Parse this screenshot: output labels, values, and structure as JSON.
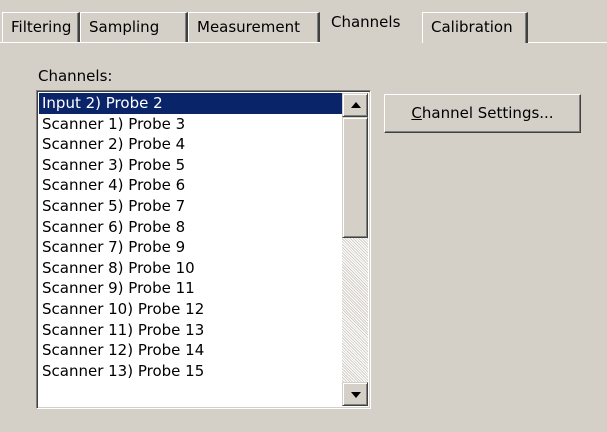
{
  "tabs": [
    {
      "label": "Filtering"
    },
    {
      "label": "Sampling"
    },
    {
      "label": "Measurement"
    },
    {
      "label": "Channels",
      "active": true
    },
    {
      "label": "Calibration"
    }
  ],
  "channels": {
    "label": "Channels:",
    "items": [
      "Input 2) Probe 2",
      "Scanner 1) Probe 3",
      "Scanner 2) Probe 4",
      "Scanner 3) Probe 5",
      "Scanner 4) Probe 6",
      "Scanner 5) Probe 7",
      "Scanner 6) Probe 8",
      "Scanner 7) Probe 9",
      "Scanner 8) Probe 10",
      "Scanner 9) Probe 11",
      "Scanner 10) Probe 12",
      "Scanner 11) Probe 13",
      "Scanner 12) Probe 14",
      "Scanner 13) Probe 15"
    ],
    "selected_index": 0
  },
  "buttons": {
    "channel_settings": {
      "mnemonic": "C",
      "rest": "hannel Settings..."
    }
  },
  "colors": {
    "face": "#d4d0c8",
    "selection": "#0a246a"
  },
  "icons": {
    "scroll_up": "up-arrow-icon",
    "scroll_down": "down-arrow-icon"
  }
}
